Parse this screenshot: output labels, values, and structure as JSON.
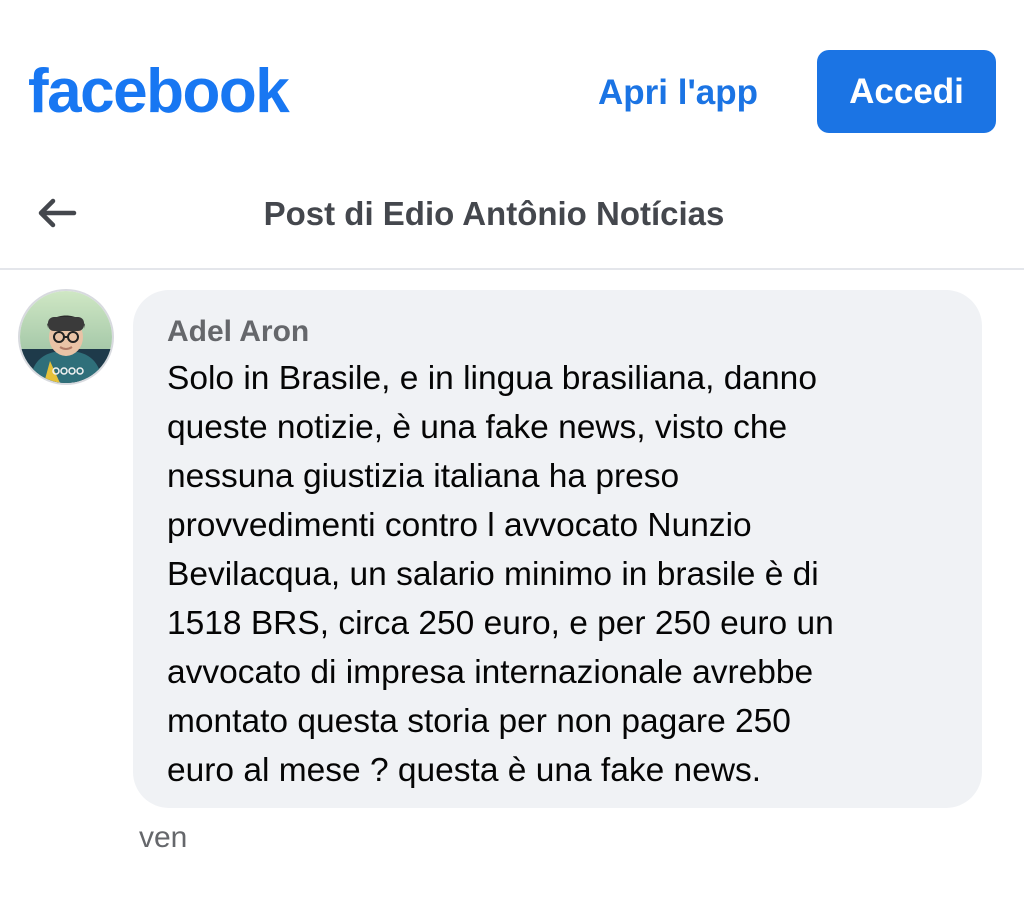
{
  "header": {
    "logo_text": "facebook",
    "open_app_label": "Apri l'app",
    "login_label": "Accedi",
    "brand_color": "#1877f2"
  },
  "subheader": {
    "back_icon": "arrow-left-icon",
    "title": "Post di Edio Antônio Notícias"
  },
  "comment": {
    "author": "Adel Aron",
    "text": "Solo in Brasile, e in lingua brasiliana, danno\nqueste notizie, è una fake news, visto che\nnessuna giustizia italiana ha preso\nprovvedimenti contro l avvocato Nunzio\nBevilacqua, un salario minimo in brasile è di\n1518 BRS, circa 250 euro, e per 250 euro un\navvocato di impresa internazionale avrebbe\nmontato questa storia per non pagare 250\neuro al mese ? questa è una fake news.",
    "timestamp": "ven",
    "bubble_color": "#f0f2f5"
  }
}
